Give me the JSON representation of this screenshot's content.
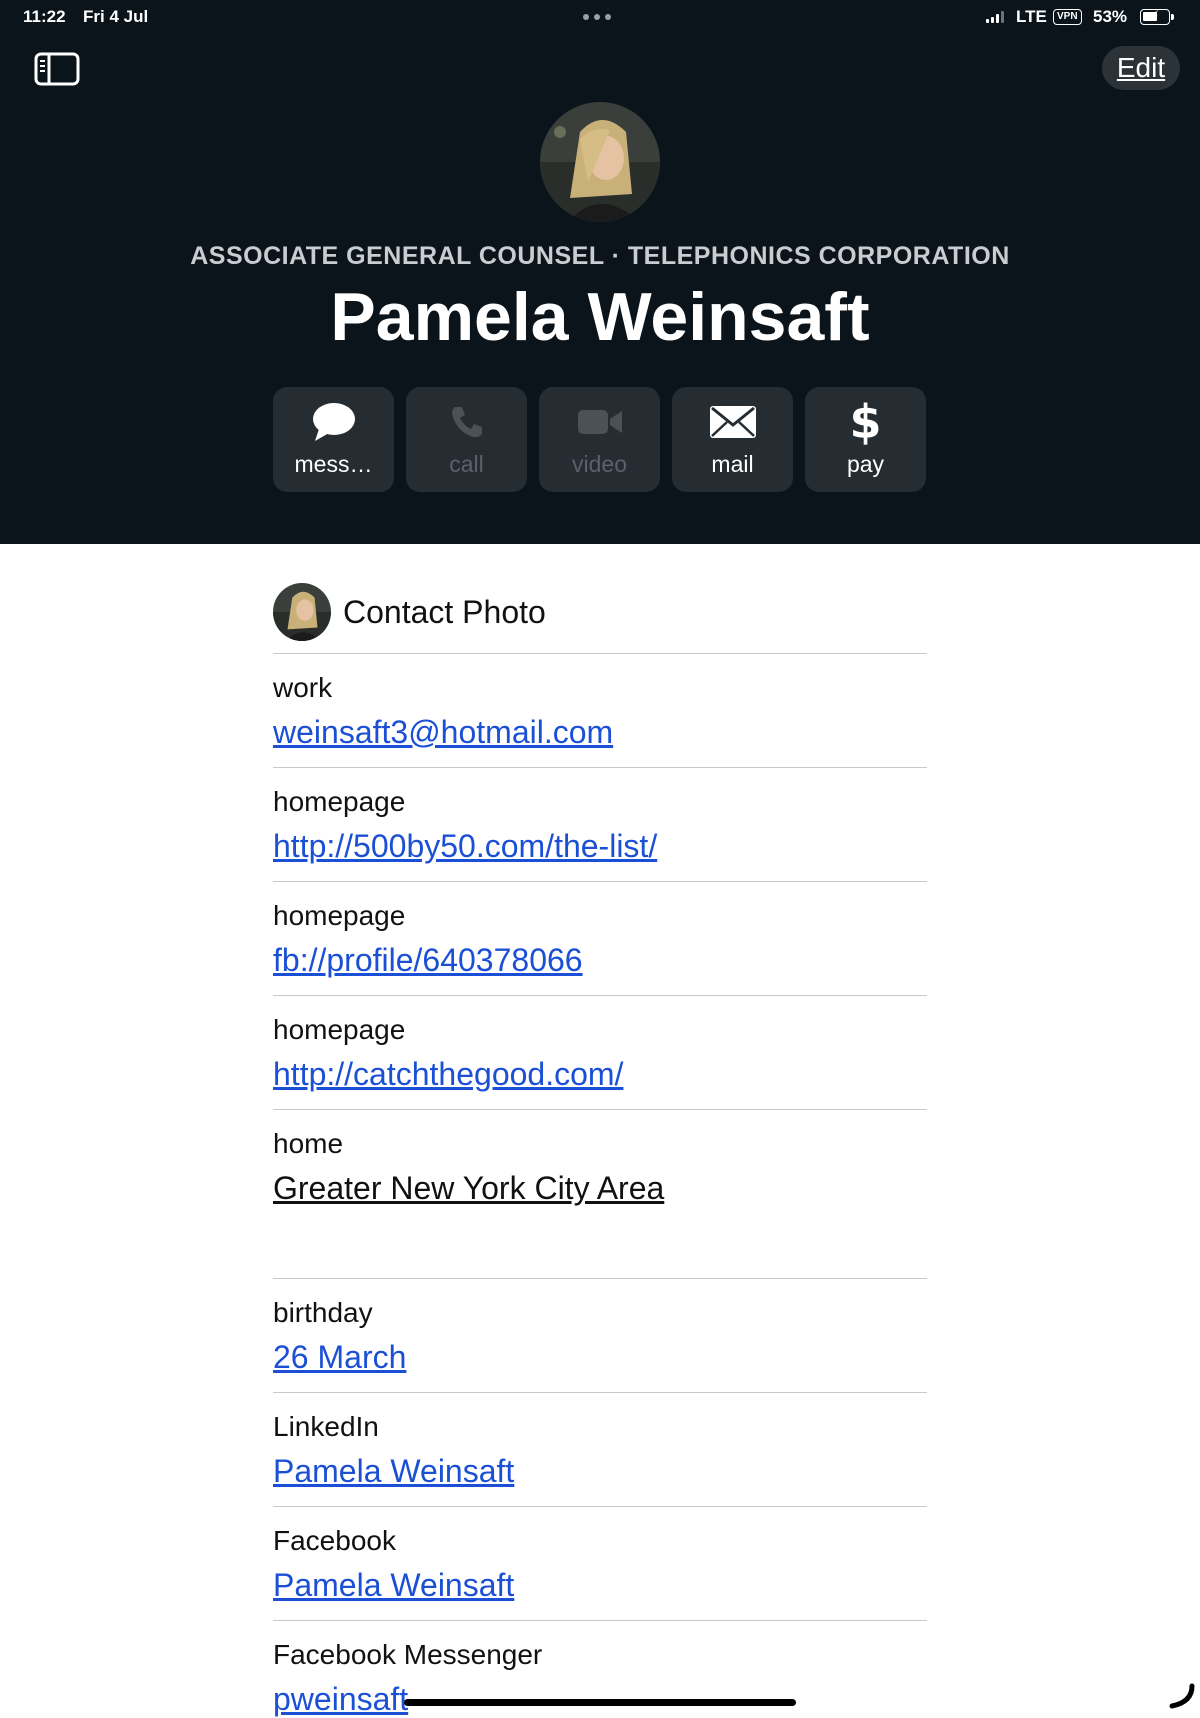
{
  "status_bar": {
    "time": "11:22",
    "date": "Fri 4 Jul",
    "network": "LTE",
    "vpn": "VPN",
    "battery": "53%",
    "battery_level": 0.53
  },
  "toolbar": {
    "sidebar_icon": "sidebar-icon",
    "edit_label": "Edit"
  },
  "contact": {
    "job_title_line": "ASSOCIATE GENERAL COUNSEL · TELEPHONICS CORPORATION",
    "name": "Pamela Weinsaft"
  },
  "actions": [
    {
      "label": "mess…",
      "icon": "message-bubble-icon",
      "enabled": true
    },
    {
      "label": "call",
      "icon": "phone-icon",
      "enabled": false
    },
    {
      "label": "video",
      "icon": "video-camera-icon",
      "enabled": false
    },
    {
      "label": "mail",
      "icon": "envelope-icon",
      "enabled": true
    },
    {
      "label": "pay",
      "icon": "dollar-icon",
      "enabled": true
    }
  ],
  "contact_photo": {
    "label": "Contact Photo"
  },
  "fields": [
    {
      "label": "work",
      "value": "weinsaft3@hotmail.com"
    },
    {
      "label": "homepage",
      "value": "http://500by50.com/the-list/"
    },
    {
      "label": "homepage",
      "value": "fb://profile/640378066"
    },
    {
      "label": "homepage",
      "value": "http://catchthegood.com/"
    },
    {
      "label": "home",
      "value": "Greater New York City Area"
    },
    {
      "label": "birthday",
      "value": "26 March"
    },
    {
      "label": "LinkedIn",
      "value": "Pamela Weinsaft"
    },
    {
      "label": "Facebook",
      "value": "Pamela Weinsaft"
    },
    {
      "label": "Facebook Messenger",
      "value": "pweinsaft"
    }
  ],
  "colors": {
    "header_bg": "#0b141b",
    "button_bg": "#252c32",
    "link": "#1a4fd6",
    "divider": "#c8c8cc"
  }
}
